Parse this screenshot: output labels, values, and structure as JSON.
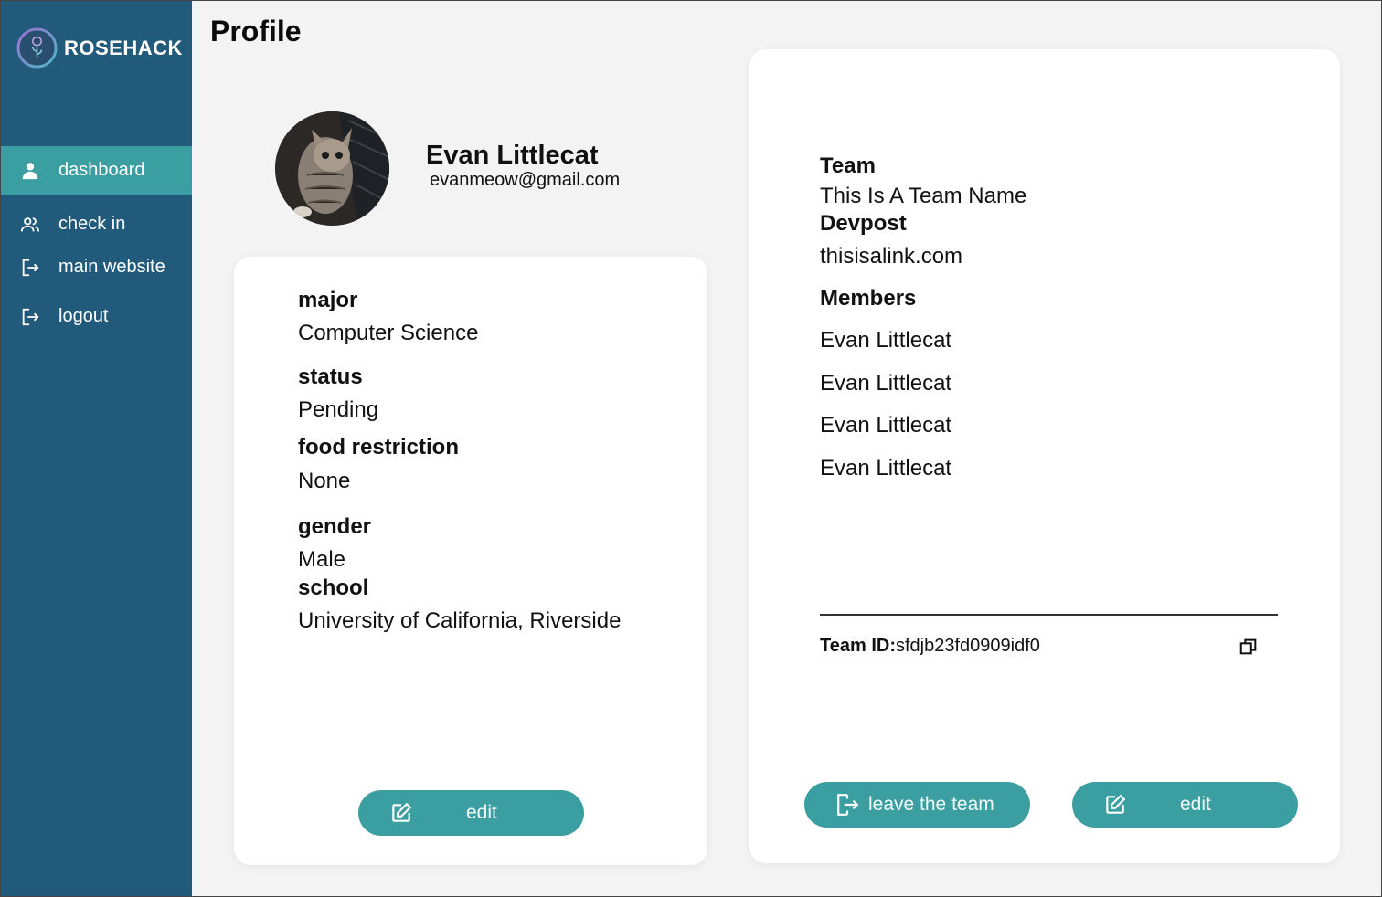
{
  "brand": {
    "name": "ROSEHACK",
    "logo_icon": "rose-logo-icon"
  },
  "sidebar": {
    "items": [
      {
        "label": "dashboard",
        "icon": "user-icon",
        "active": true
      },
      {
        "label": "check in",
        "icon": "users-icon",
        "active": false
      },
      {
        "label": "main website",
        "icon": "exit-icon",
        "active": false
      },
      {
        "label": "logout",
        "icon": "exit-icon",
        "active": false
      }
    ]
  },
  "page": {
    "title": "Profile"
  },
  "profile": {
    "name": "Evan Littlecat",
    "email": "evanmeow@gmail.com",
    "fields": [
      {
        "label": "major",
        "value": "Computer Science"
      },
      {
        "label": "status",
        "value": "Pending"
      },
      {
        "label": "food restriction",
        "value": "None"
      },
      {
        "label": "gender",
        "value": "Male"
      },
      {
        "label": "school",
        "value": "University of California, Riverside"
      }
    ],
    "edit_label": "edit"
  },
  "team": {
    "team_label": "Team",
    "team_name": "This Is A Team Name",
    "devpost_label": "Devpost",
    "devpost_link": "thisisalink.com",
    "members_label": "Members",
    "members": [
      "Evan Littlecat",
      "Evan Littlecat",
      "Evan Littlecat",
      "Evan Littlecat"
    ],
    "team_id_label": "Team ID:",
    "team_id": "sfdjb23fd0909idf0",
    "leave_label": "leave the team",
    "edit_label": "edit"
  },
  "colors": {
    "sidebar": "#225a7b",
    "accent": "#3b9ea0",
    "background": "#f3f3f3"
  }
}
